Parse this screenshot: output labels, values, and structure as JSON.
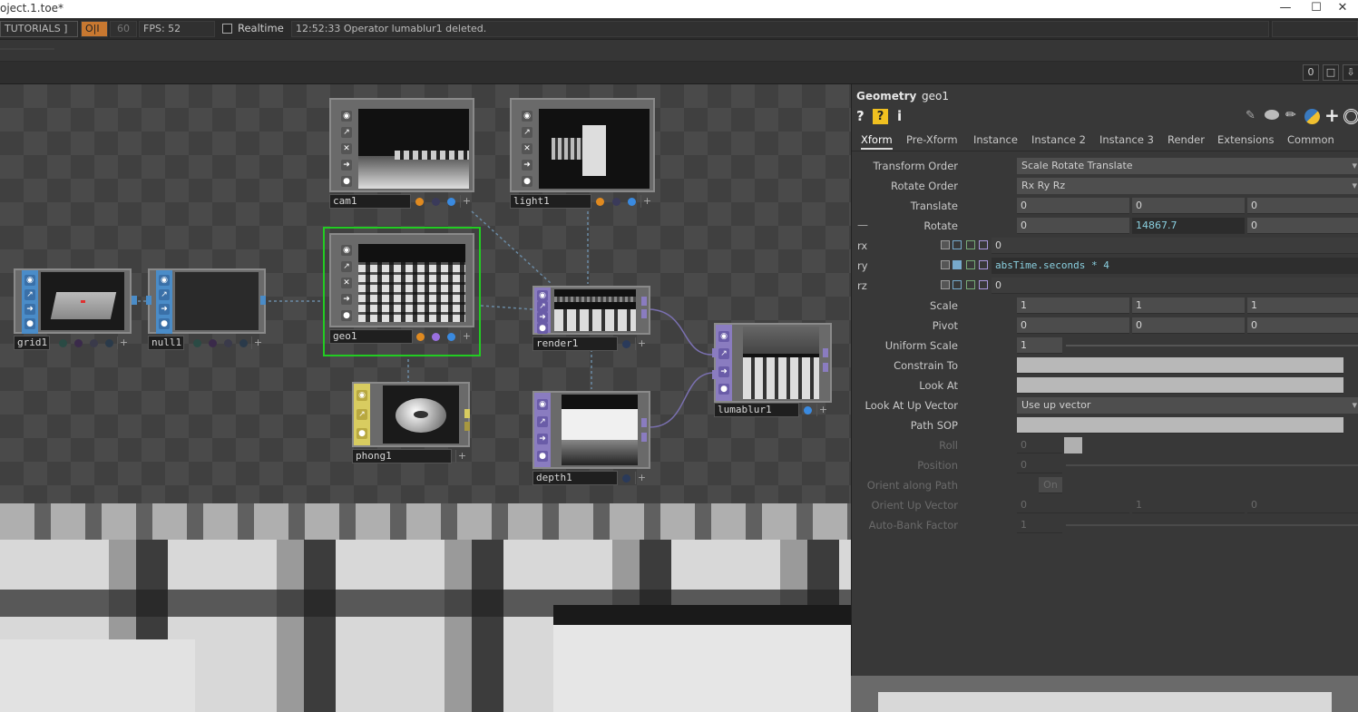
{
  "window": {
    "title": "oject.1.toe*",
    "controls": [
      "—",
      "☐",
      "✕"
    ]
  },
  "toolbar": {
    "tutorials": "TUTORIALS ]",
    "oi": "O|I",
    "fps_cap": "60",
    "fps": "FPS: 52",
    "realtime": "Realtime",
    "status": "12:52:33 Operator lumablur1 deleted."
  },
  "panebar": {
    "zero": "0"
  },
  "nodes": {
    "cam1": "cam1",
    "light1": "light1",
    "geo1": "geo1",
    "grid1": "grid1",
    "null1": "null1",
    "render1": "render1",
    "phong1": "phong1",
    "depth1": "depth1",
    "lumablur1": "lumablur1"
  },
  "params": {
    "op_type": "Geometry",
    "op_name": "geo1",
    "tabs": [
      "Xform",
      "Pre-Xform",
      "Instance",
      "Instance 2",
      "Instance 3",
      "Render",
      "Extensions",
      "Common"
    ],
    "transform_order": {
      "label": "Transform Order",
      "value": "Scale Rotate Translate"
    },
    "rotate_order": {
      "label": "Rotate Order",
      "value": "Rx Ry Rz"
    },
    "translate": {
      "label": "Translate",
      "values": [
        "0",
        "0",
        "0"
      ]
    },
    "rotate": {
      "label": "Rotate",
      "values": [
        "0",
        "14867.7",
        "0"
      ]
    },
    "rx": {
      "label": "rx",
      "value": "0"
    },
    "ry": {
      "label": "ry",
      "value": "absTime.seconds * 4"
    },
    "rz": {
      "label": "rz",
      "value": "0"
    },
    "scale": {
      "label": "Scale",
      "values": [
        "1",
        "1",
        "1"
      ]
    },
    "pivot": {
      "label": "Pivot",
      "values": [
        "0",
        "0",
        "0"
      ]
    },
    "uniform_scale": {
      "label": "Uniform Scale",
      "value": "1"
    },
    "constrain_to": {
      "label": "Constrain To"
    },
    "look_at": {
      "label": "Look At"
    },
    "look_at_up": {
      "label": "Look At Up Vector",
      "value": "Use up vector"
    },
    "path_sop": {
      "label": "Path SOP"
    },
    "roll": {
      "label": "Roll",
      "value": "0"
    },
    "position": {
      "label": "Position",
      "value": "0"
    },
    "orient_path": {
      "label": "Orient along Path",
      "value": "On"
    },
    "orient_up": {
      "label": "Orient Up Vector",
      "values": [
        "0",
        "1",
        "0"
      ]
    },
    "auto_bank": {
      "label": "Auto-Bank Factor",
      "value": "1"
    }
  },
  "colors": {
    "comp_blue": "#4a8cc8",
    "top_purple": "#8a7cc0",
    "mat_yellow": "#d8cc60",
    "selected": "#22cc22"
  }
}
